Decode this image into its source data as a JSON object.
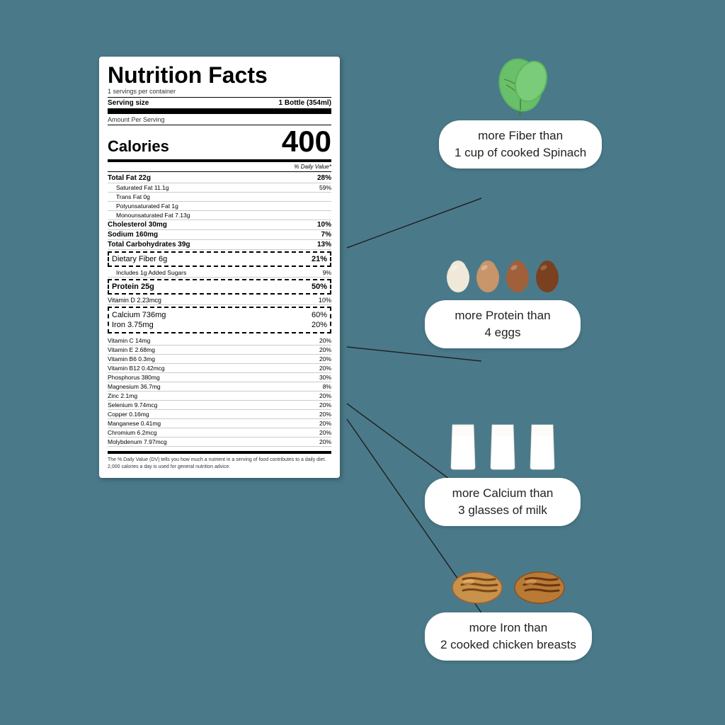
{
  "page": {
    "background_color": "#4a7a8a"
  },
  "nutrition": {
    "title": "Nutrition Facts",
    "servings_per_container": "1 servings per container",
    "serving_size_label": "Serving size",
    "serving_size_value": "1 Bottle (354ml)",
    "amount_per_serving": "Amount Per Serving",
    "calories_label": "Calories",
    "calories_value": "400",
    "daily_value_header": "% Daily Value*",
    "nutrients": [
      {
        "label": "Total Fat 22g",
        "pct": "28%",
        "bold": true
      },
      {
        "label": "Saturated Fat 11.1g",
        "pct": "59%",
        "indented": true
      },
      {
        "label": "Trans Fat 0g",
        "indented": true
      },
      {
        "label": "Polyunsaturated Fat 1g",
        "indented": true
      },
      {
        "label": "Monounsaturated Fat 7.13g",
        "indented": true
      },
      {
        "label": "Cholesterol 30mg",
        "pct": "10%",
        "bold": true
      },
      {
        "label": "Sodium 160mg",
        "pct": "7%",
        "bold": true
      },
      {
        "label": "Total Carbohydrates 39g",
        "pct": "13%",
        "bold": true
      }
    ],
    "highlighted": [
      {
        "label": "Dietary Fiber 6g",
        "pct": "21%",
        "bold": false
      },
      {
        "label": "Protein 25g",
        "pct": "50%",
        "bold": true
      }
    ],
    "calcium_row": {
      "label": "Calcium 736mg",
      "pct": "60%"
    },
    "iron_row": {
      "label": "Iron 3.75mg",
      "pct": "20%"
    },
    "vitamins": [
      {
        "label": "Vitamin C 14mg",
        "pct": "20%"
      },
      {
        "label": "Vitamin E 2.68mg",
        "pct": "20%"
      },
      {
        "label": "Vitamin B6 0.3mg",
        "pct": "20%"
      },
      {
        "label": "Vitamin B12 0.42mcg",
        "pct": "20%"
      },
      {
        "label": "Phosphorus 380mg",
        "pct": "30%"
      },
      {
        "label": "Magnesium 36.7mg",
        "pct": "8%"
      },
      {
        "label": "Zinc 2.1mg",
        "pct": "20%"
      },
      {
        "label": "Selenium 9.74mcg",
        "pct": "20%"
      },
      {
        "label": "Copper 0.16mg",
        "pct": "20%"
      },
      {
        "label": "Manganese 0.41mg",
        "pct": "20%"
      },
      {
        "label": "Chromium 6.2mcg",
        "pct": "20%"
      },
      {
        "label": "Molybdenum 7.97mcg",
        "pct": "20%"
      }
    ],
    "disclaimer": "The % Daily Value (DV) tells you how much a nutrient in a serving of food contributes to a daily diet. 2,000 calories a day is used for general nutrition advice."
  },
  "comparisons": [
    {
      "id": "fiber",
      "bubble_text": "more Fiber than\n1 cup of cooked Spinach",
      "icon_type": "spinach"
    },
    {
      "id": "protein",
      "bubble_text": "more Protein than\n4 eggs",
      "icon_type": "eggs"
    },
    {
      "id": "calcium",
      "bubble_text": "more Calcium than\n3 glasses of milk",
      "icon_type": "milk"
    },
    {
      "id": "iron",
      "bubble_text": "more Iron than\n2 cooked chicken breasts",
      "icon_type": "chicken"
    }
  ]
}
